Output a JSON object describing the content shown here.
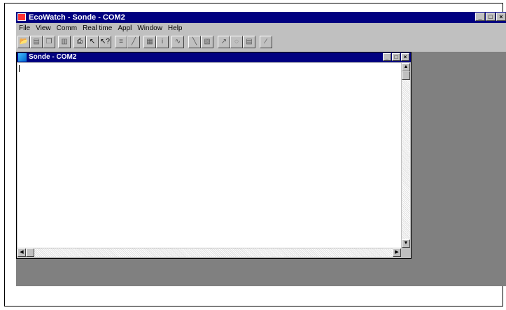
{
  "app": {
    "title": "EcoWatch - Sonde - COM2",
    "window_buttons": [
      "_",
      "□",
      "×"
    ]
  },
  "menu": [
    "File",
    "View",
    "Comm",
    "Real time",
    "Appl",
    "Window",
    "Help"
  ],
  "toolbar": {
    "buttons": [
      "open-icon",
      "save-icon",
      "copy-icon",
      "paste-icon",
      "print-icon",
      "pointer-icon",
      "help-pointer-icon",
      "table-icon",
      "graph-icon",
      "stats-icon",
      "info-icon",
      "wave-icon",
      "plot-icon",
      "plot2-icon",
      "zoom-icon",
      "zoom2-icon",
      "report-icon",
      "edit-icon"
    ]
  },
  "child_window": {
    "title": "Sonde - COM2",
    "buttons": [
      "_",
      "□",
      "×"
    ]
  },
  "colors": {
    "title_bar": "#000080",
    "face": "#c0c0c0",
    "mdi_background": "#808080"
  }
}
